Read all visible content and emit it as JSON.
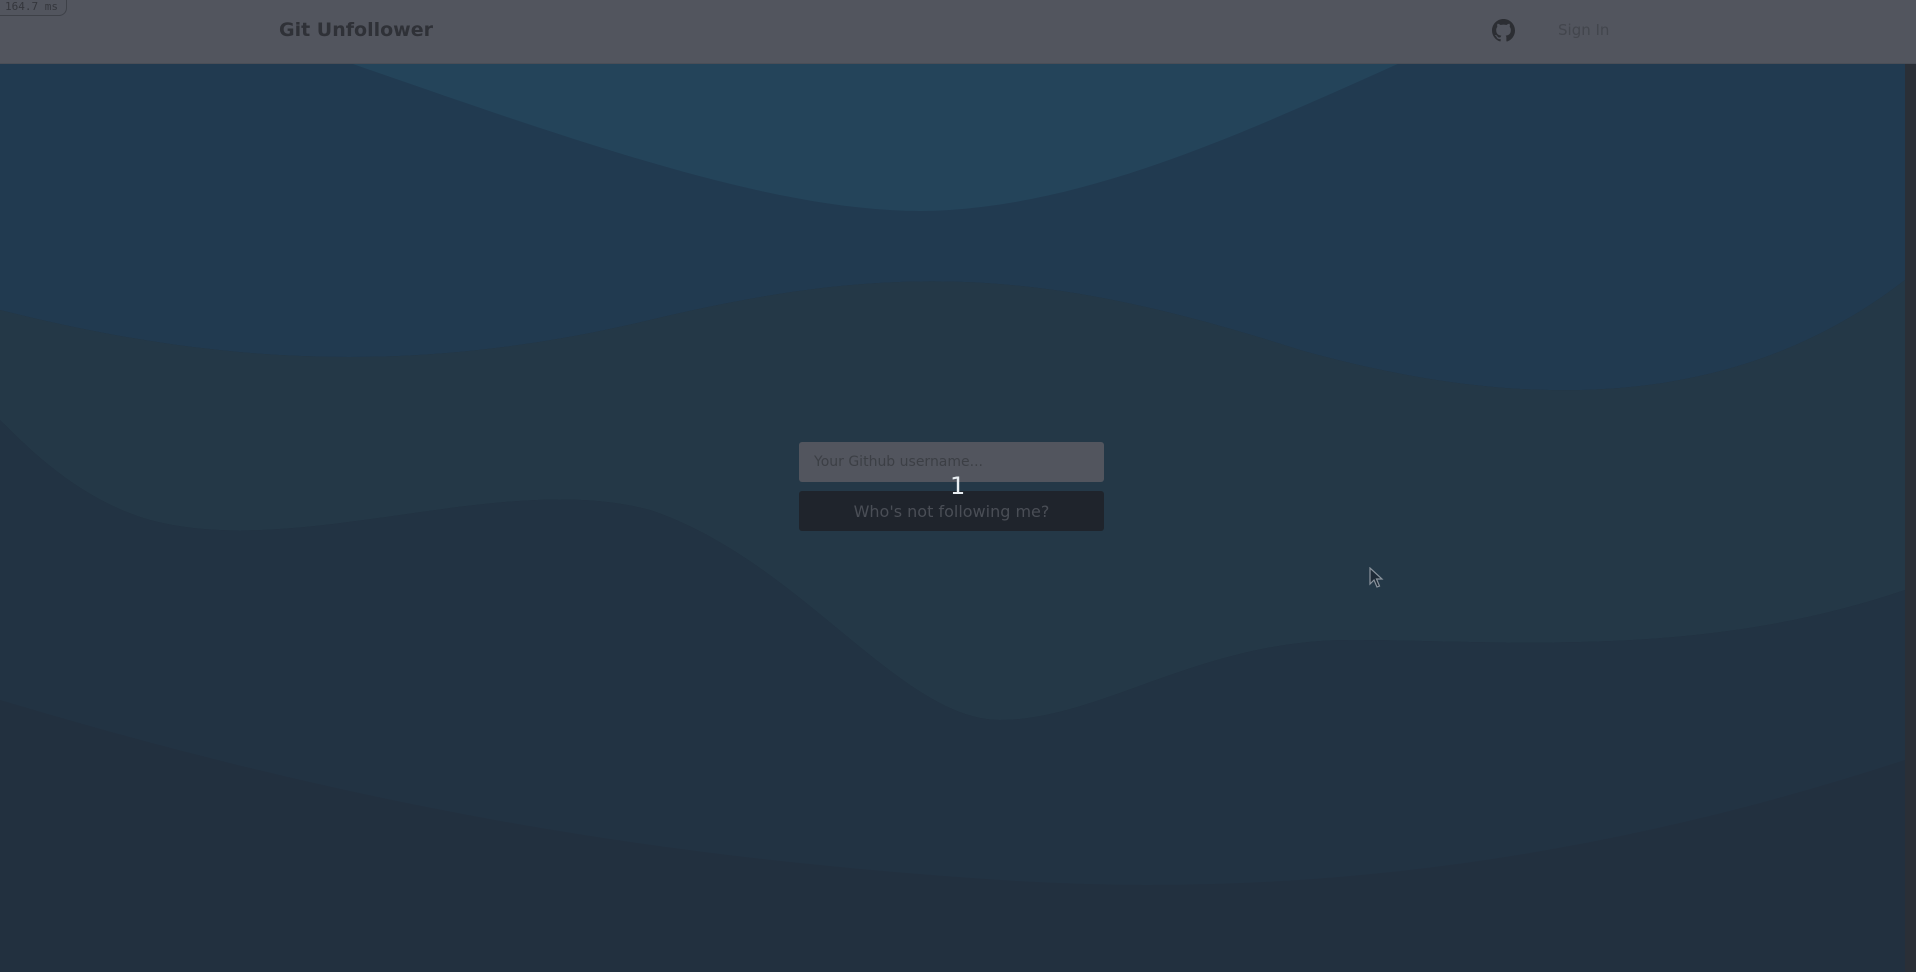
{
  "debug": {
    "timer": "164.7 ms"
  },
  "header": {
    "title": "Git Unfollower",
    "github_icon": "github-icon",
    "sign_in_label": "Sign In"
  },
  "form": {
    "username_placeholder": "Your Github username...",
    "submit_label": "Who's not following me?"
  },
  "annotation": {
    "marker": "1"
  },
  "colors": {
    "header": "#52555e",
    "background": "#22303f",
    "wave_top": "#24445a",
    "wave_mid": "#233a4b",
    "button": "#1f242c"
  }
}
